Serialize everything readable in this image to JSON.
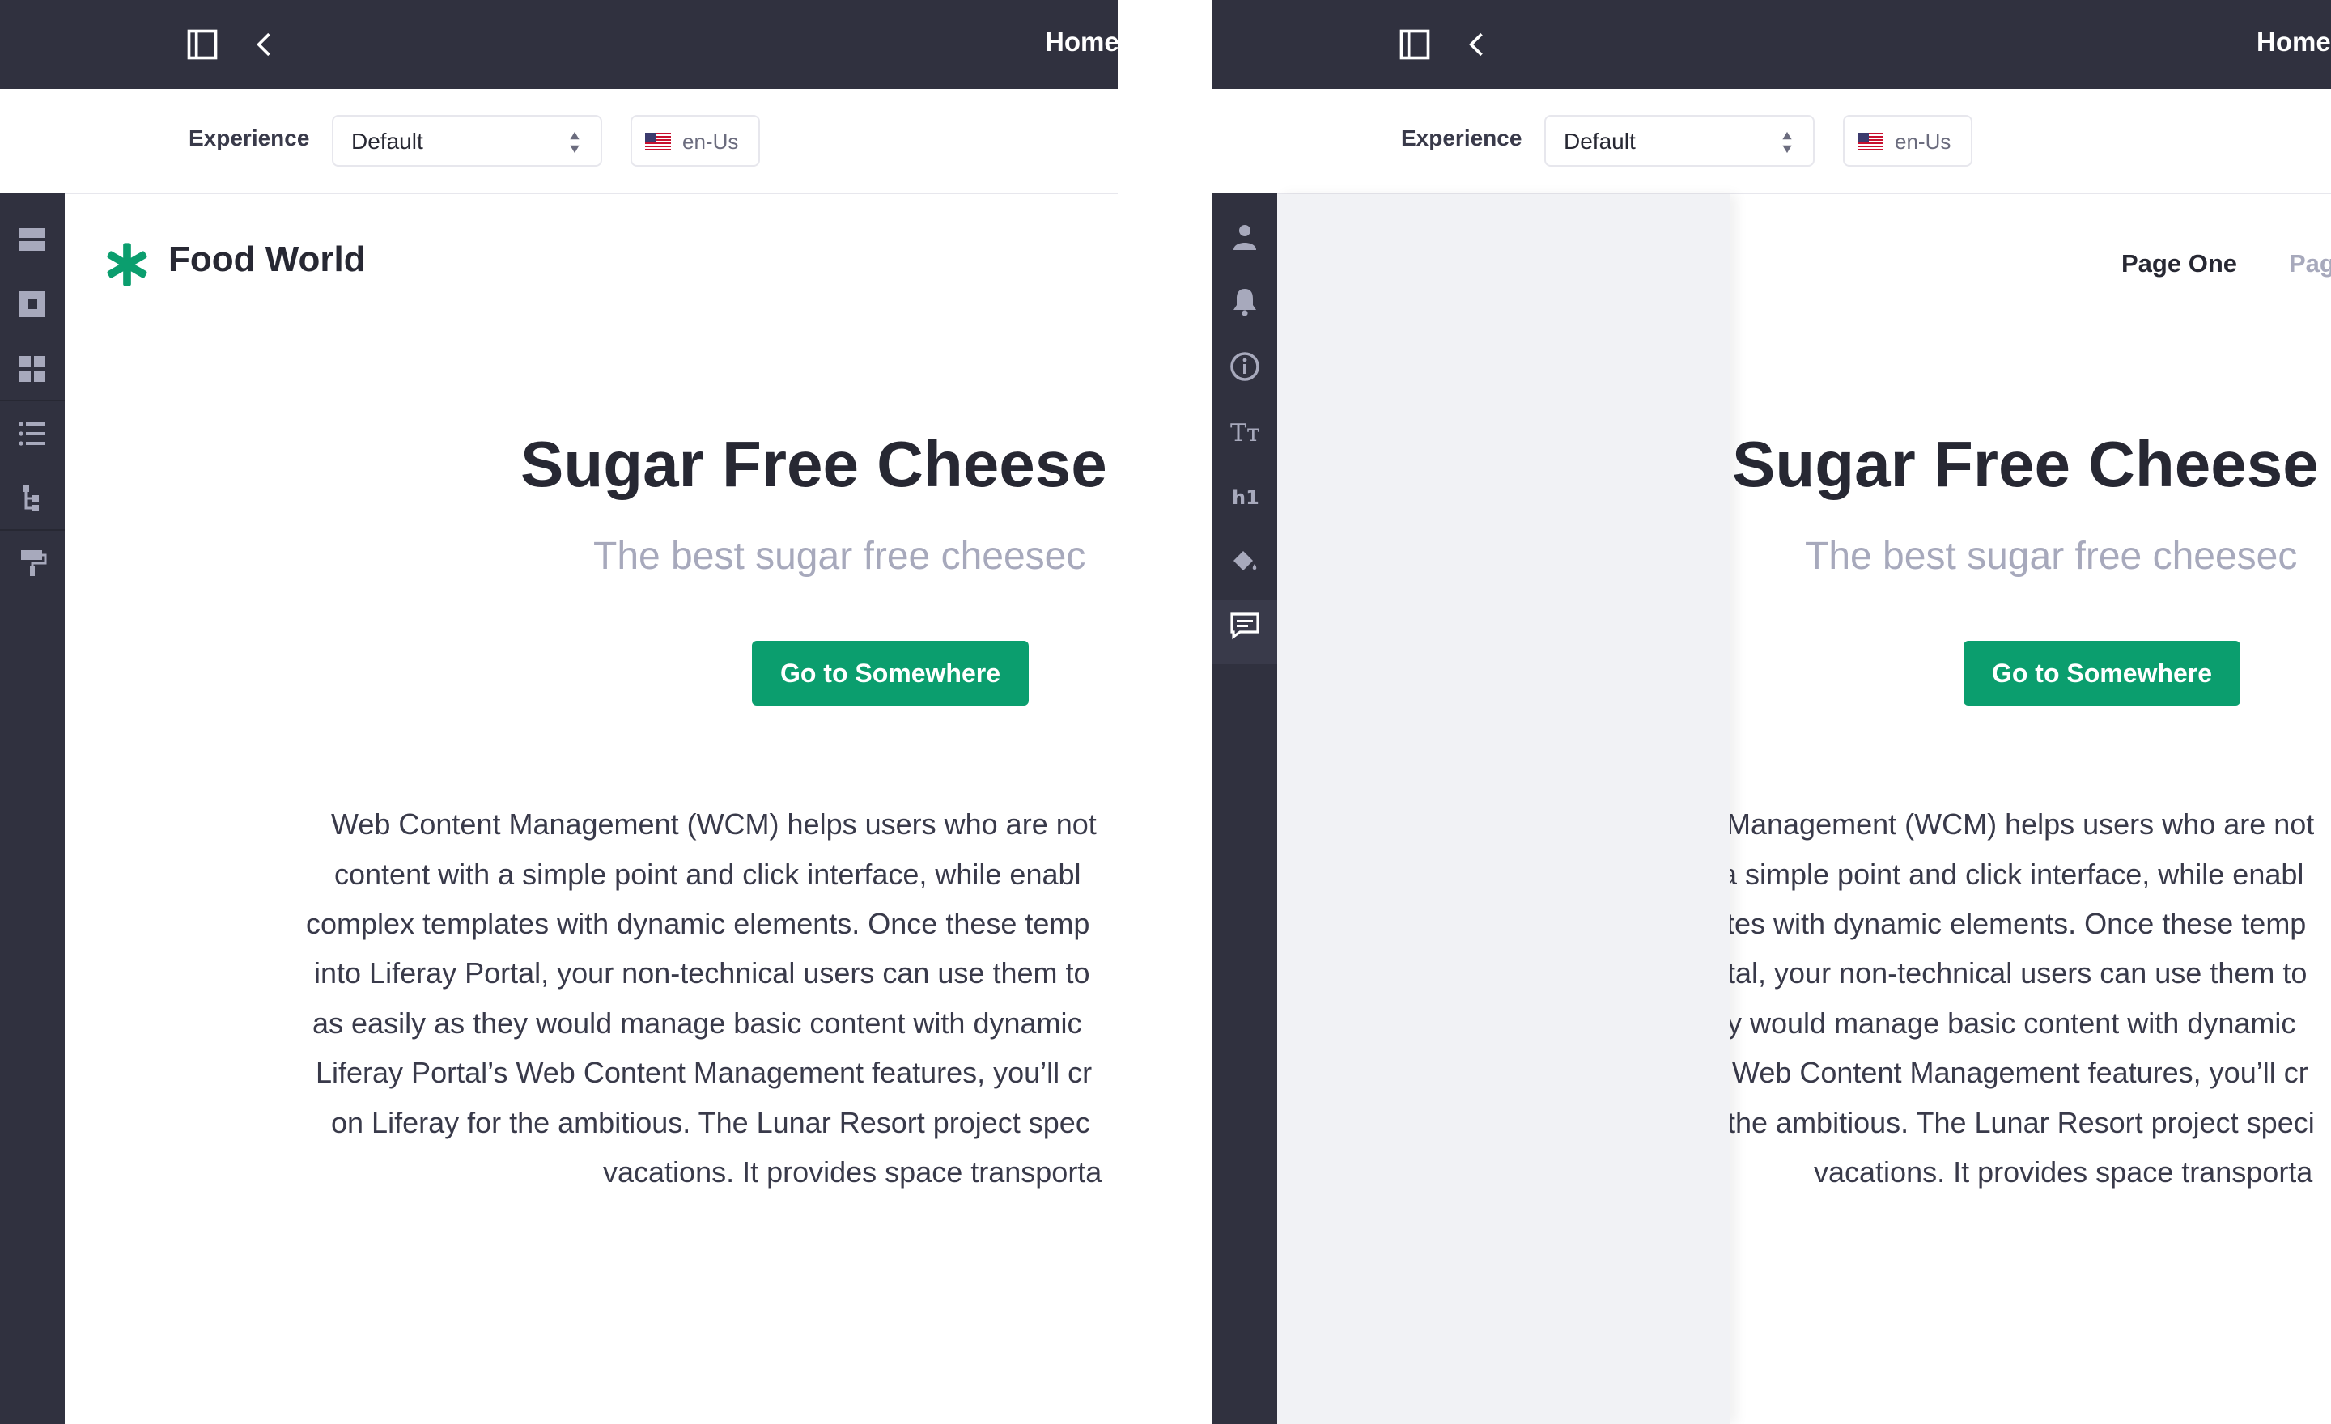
{
  "header": {
    "title": "Home"
  },
  "toolbar": {
    "experience_label": "Experience",
    "experience_value": "Default",
    "language_code": "en-Us"
  },
  "left_rail": {
    "icons": [
      "sections-icon",
      "fragments-icon",
      "widgets-icon",
      "contents-icon",
      "page-structure-icon",
      "look-and-feel-icon"
    ]
  },
  "right_rail": {
    "icons": [
      "user-icon",
      "bell-icon",
      "info-icon",
      "text-format-icon",
      "heading-icon",
      "paint-bucket-icon",
      "comments-icon"
    ]
  },
  "site": {
    "name": "Food World",
    "nav": [
      "Page One",
      "Pag"
    ]
  },
  "hero": {
    "title": "Sugar Free Cheese",
    "subtitle": "The best sugar free cheesec",
    "cta_label": "Go to Somewhere"
  },
  "content_left": [
    "Web Content Management (WCM) helps users who are not",
    "content with a simple point and click interface, while enabl",
    "complex templates with dynamic elements. Once these temp",
    "into Liferay Portal, your non-technical users can use them to",
    "as easily as they would manage basic content with dynamic",
    "Liferay Portal’s Web Content Management features, you’ll cr",
    "on Liferay for the ambitious. The Lunar Resort project spec",
    "vacations. It provides space transporta"
  ],
  "content_right": [
    "Management (WCM) helps users who are not",
    "a simple point and click interface, while enabl",
    "tes with dynamic elements. Once these temp",
    "tal, your non-technical users can use them to",
    "y would manage basic content with dynamic",
    "Web Content Management features, you’ll cr",
    "the ambitious. The Lunar Resort project speci",
    "vacations. It provides space transporta"
  ],
  "colors": {
    "dark": "#30313f",
    "accent": "#0b9e6e",
    "muted": "#a7a9bc"
  }
}
